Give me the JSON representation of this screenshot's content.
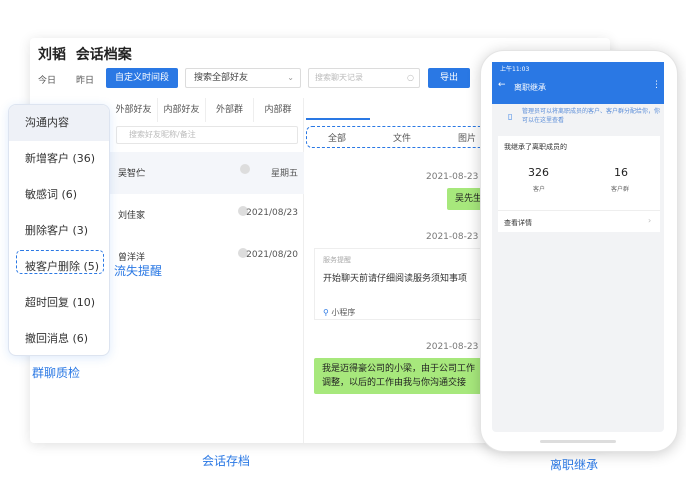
{
  "header": {
    "name": "刘韬",
    "title": "会话档案",
    "today": "今日",
    "yesterday": "昨日",
    "custom_range": "自定义时间段",
    "friend_select": "搜索全部好友",
    "search_placeholder": "搜索聊天记录",
    "export": "导出"
  },
  "contacts": {
    "tabs": [
      "外部好友",
      "内部好友",
      "外部群",
      "内部群"
    ],
    "search_placeholder": "搜索好友昵称/备注",
    "items": [
      {
        "name": "吴智伫",
        "date": "星期五"
      },
      {
        "name": "刘佳家",
        "date": "2021/08/23"
      },
      {
        "name": "曾洋洋",
        "date": "2021/08/20"
      }
    ]
  },
  "chat": {
    "tabs": [
      "全部",
      "文件",
      "图片"
    ],
    "messages": [
      {
        "date": "2021-08-23",
        "text": "吴先生"
      },
      {
        "date": "2021-08-23",
        "card_header": "服务提醒",
        "card_body": "开始聊天前请仔细阅读服务须知事项",
        "card_footer": "小程序"
      },
      {
        "date": "2021-08-23",
        "text": "我是迈得豪公司的小梁，由于公司工作调整，以后的工作由我与你沟通交接"
      }
    ]
  },
  "left_panel": {
    "items": [
      "沟通内容",
      "新增客户 (36)",
      "敏感词 (6)",
      "删除客户 (3)",
      "被客户删除 (5)",
      "超时回复 (10)",
      "撤回消息 (6)"
    ]
  },
  "labels": {
    "lost_reminder": "流失提醒",
    "group_quality": "群聊质检",
    "session_archive": "会话存档",
    "resign_inherit": "离职继承"
  },
  "phone": {
    "status_time": "上午11:03",
    "title": "离职继承",
    "notice": "管理员可以将离职成员的客户、客户群分配给你，你可以在这里查看",
    "card_title": "我继承了离职成员的",
    "customers_count": "326",
    "customers_label": "客户",
    "groups_count": "16",
    "groups_label": "客户群",
    "detail_link": "查看详情"
  },
  "colors": {
    "accent": "#2a78e4",
    "bubble": "#a7e87c"
  }
}
